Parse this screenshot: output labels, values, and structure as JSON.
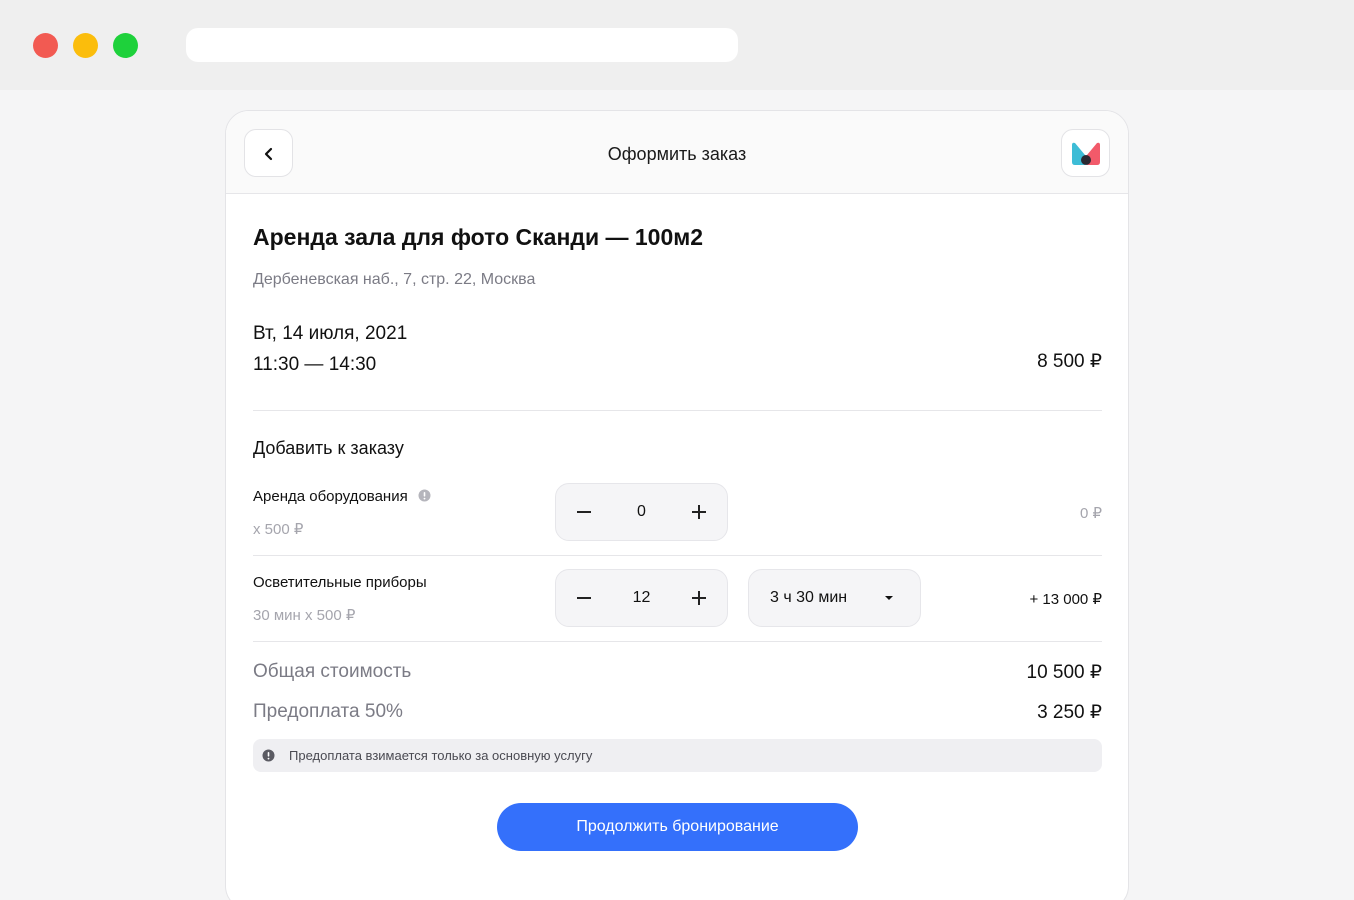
{
  "header": {
    "title": "Оформить заказ"
  },
  "booking": {
    "title": "Аренда зала для фото Сканди — 100м2",
    "address": "Дербеневская наб., 7, стр. 22, Москва",
    "date": "Вт, 14 июля, 2021",
    "time": "11:30 — 14:30",
    "price": "8 500 ₽"
  },
  "extras": {
    "title": "Добавить к заказу",
    "items": [
      {
        "label": "Аренда оборудования",
        "sub": "x 500 ₽",
        "quantity": "0",
        "price": "0 ₽"
      },
      {
        "label": "Осветительные приборы",
        "sub": "30 мин x 500 ₽",
        "quantity": "12",
        "duration": "3 ч 30 мин",
        "price": "+ 13 000 ₽"
      }
    ]
  },
  "summary": {
    "total_label": "Общая стоимость",
    "total_value": "10 500 ₽",
    "prepay_label": "Предоплата 50%",
    "prepay_value": "3 250 ₽"
  },
  "notice": {
    "text": "Предоплата взимается только за основную услугу"
  },
  "cta": {
    "label": "Продолжить бронирование"
  },
  "colors": {
    "accent": "#3470fb",
    "muted_text": "#7b7b85"
  },
  "icons": {
    "back": "chevron-left-icon",
    "logo": "brand-logo-icon",
    "info": "info-icon",
    "dropdown": "caret-down-icon"
  }
}
